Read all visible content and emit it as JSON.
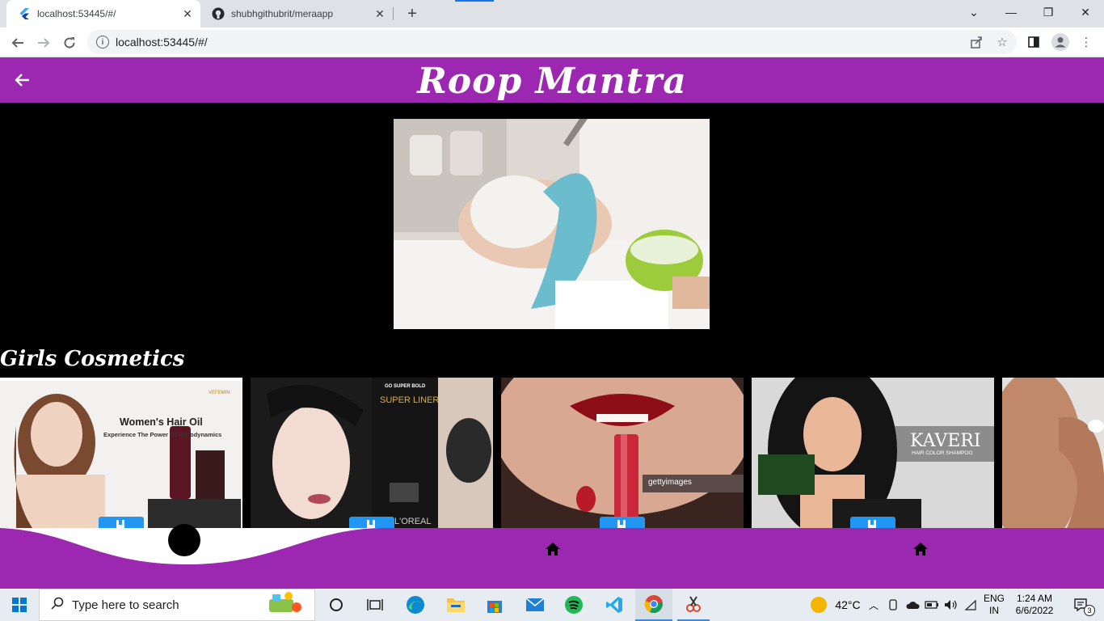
{
  "browser": {
    "tabs": [
      {
        "title": "localhost:53445/#/",
        "active": true,
        "icon": "flutter-icon"
      },
      {
        "title": "shubhgithubrit/meraapp",
        "active": false,
        "icon": "github-icon"
      }
    ],
    "url": "localhost:53445/#/"
  },
  "app": {
    "title": "Roop  Mantra",
    "section_title": "Girls Cosmetics",
    "accent_color": "#9c27b0",
    "cards": [
      {
        "headline": "Women's Hair Oil",
        "sub": "Experience The Power Of Hairodynamics",
        "brand": "VEFEMIN"
      },
      {
        "headline": "GO SUPER BOLD",
        "sub": "SUPER LINER",
        "brand": "L'OREAL"
      },
      {
        "headline": "",
        "sub": "",
        "brand": "gettyimages"
      },
      {
        "headline": "KAVERI",
        "sub": "HAIR COLOR SHAMPOO",
        "brand": "KAVERI"
      },
      {
        "headline": "",
        "sub": "",
        "brand": ""
      }
    ]
  },
  "taskbar": {
    "search_placeholder": "Type here to search",
    "weather": "42°C",
    "language_line1": "ENG",
    "language_line2": "IN",
    "time": "1:24 AM",
    "date": "6/6/2022",
    "notification_count": "3"
  }
}
